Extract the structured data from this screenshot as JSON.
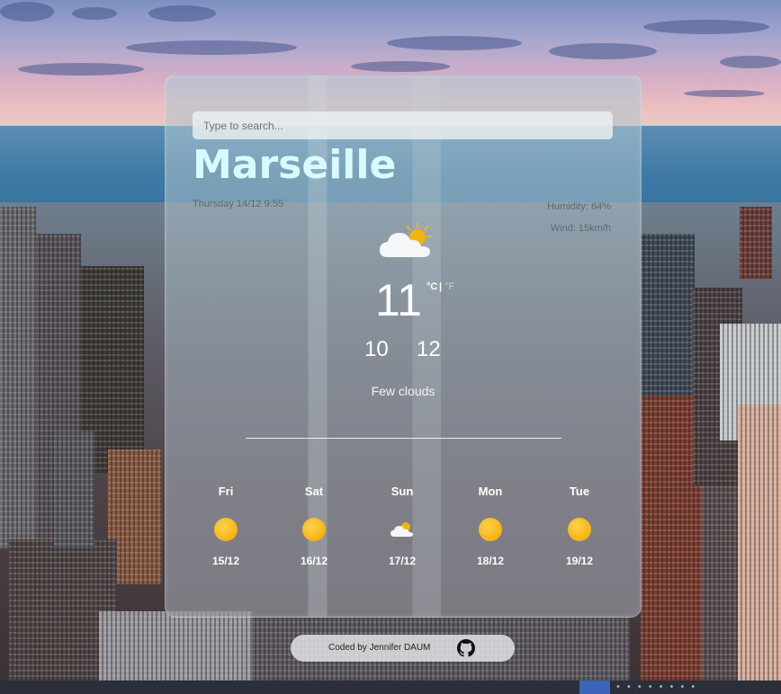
{
  "search": {
    "placeholder": "Type to search..."
  },
  "current": {
    "city": "Marseille",
    "date": "Thursday 14/12 9:55",
    "humidity": "Humidity: 64%",
    "wind": "Wind: 15km/h",
    "icon": "sun-behind-cloud-icon",
    "temperature": "11",
    "unit_c": "°C",
    "unit_separator": "|",
    "unit_f": "°F",
    "temp_min": "10",
    "temp_max": "12",
    "description": "Few clouds"
  },
  "forecast": [
    {
      "day": "Fri",
      "date": "15/12",
      "icon": "sun-icon"
    },
    {
      "day": "Sat",
      "date": "16/12",
      "icon": "sun-icon"
    },
    {
      "day": "Sun",
      "date": "17/12",
      "icon": "sun-behind-cloud-icon"
    },
    {
      "day": "Mon",
      "date": "18/12",
      "icon": "sun-icon"
    },
    {
      "day": "Tue",
      "date": "19/12",
      "icon": "sun-icon"
    }
  ],
  "footer": {
    "credit": "Coded by Jennifer DAUM",
    "link_icon": "github-icon"
  },
  "colors": {
    "city_name": "#d9fbff",
    "sun": "#f5b312",
    "card_glass": "rgba(160,175,185,0.62)"
  }
}
